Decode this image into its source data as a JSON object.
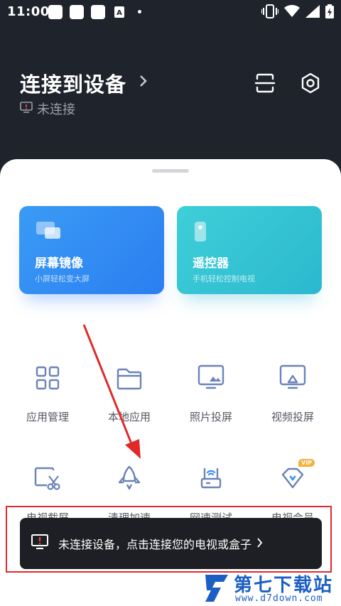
{
  "status": {
    "time": "11:00"
  },
  "header": {
    "title": "连接到设备",
    "subtitle": "未连接"
  },
  "cards": [
    {
      "title": "屏幕镜像",
      "subtitle": "小屏轻松变大屏",
      "icon": "screen-mirror-icon",
      "color": "#2f8af3"
    },
    {
      "title": "遥控器",
      "subtitle": "手机轻松控制电视",
      "icon": "remote-control-icon",
      "color": "#33c2d4"
    }
  ],
  "grid": [
    {
      "label": "应用管理",
      "icon": "app-grid-icon"
    },
    {
      "label": "本地应用",
      "icon": "folder-icon"
    },
    {
      "label": "照片投屏",
      "icon": "photo-cast-icon"
    },
    {
      "label": "视频投屏",
      "icon": "video-cast-icon"
    },
    {
      "label": "电视截屏",
      "icon": "tv-screenshot-icon"
    },
    {
      "label": "清理加速",
      "icon": "rocket-icon"
    },
    {
      "label": "网速测试",
      "icon": "router-speed-icon"
    },
    {
      "label": "电视会员",
      "icon": "vip-diamond-icon",
      "badge": "VIP"
    }
  ],
  "banner": {
    "text": "未连接设备，点击连接您的电视或盒子"
  },
  "watermark": {
    "text": "第七下载站",
    "url": "www.d7down.com"
  },
  "colors": {
    "accent": "#2f8af3",
    "icon": "#6a83b8",
    "header_bg": "#1f232b",
    "annotation": "#e02a2a"
  }
}
